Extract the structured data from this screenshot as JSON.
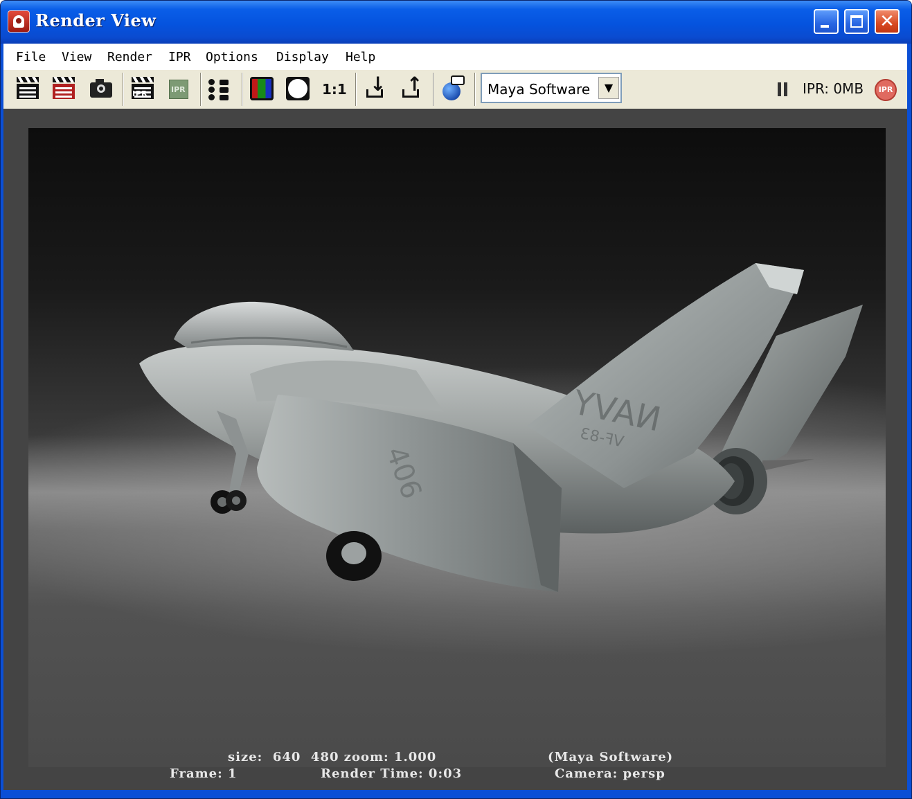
{
  "window": {
    "title": "Render View",
    "controls": [
      "minimize",
      "maximize",
      "close"
    ]
  },
  "menubar": {
    "items": [
      "File",
      "View",
      "Render",
      "IPR",
      "Options",
      "Display",
      "Help"
    ]
  },
  "toolbar": {
    "icons": [
      "redo-previous-render-icon",
      "render-region-icon",
      "snapshot-icon",
      "ipr-render-icon",
      "refresh-ipr-icon",
      "render-settings-icon",
      "display-rgb-channels-icon",
      "display-alpha-channel-icon",
      "real-size-icon",
      "keep-image-icon",
      "remove-image-icon",
      "render-diagnostics-icon"
    ],
    "real_size_label": "1:1",
    "renderer": "Maya Software",
    "ipr_status": "IPR: 0MB",
    "ipr_badge": "IPR"
  },
  "render_image": {
    "subject": "grey jet aircraft with twin tails",
    "tail_text": "NAVY",
    "tail_subtext": "VF-83",
    "wing_number": "406"
  },
  "render_info": {
    "size_line": "size:  640  480 zoom: 1.000",
    "renderer_line": "(Maya Software)",
    "frame_line": "Frame: 1",
    "render_time_line": "Render Time: 0:03",
    "camera_line": "Camera: persp"
  },
  "colors": {
    "titlebar": "#0553de",
    "toolbar": "#ece9d8",
    "viewport_frame": "#444444"
  }
}
